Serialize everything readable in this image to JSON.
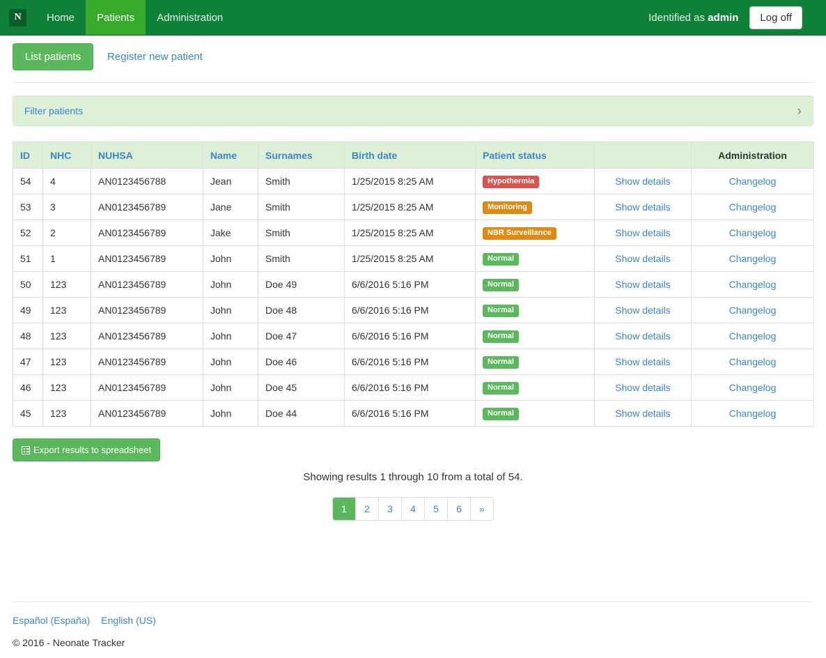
{
  "navbar": {
    "brand_letter": "N",
    "links": [
      {
        "label": "Home",
        "active": false
      },
      {
        "label": "Patients",
        "active": true
      },
      {
        "label": "Administration",
        "active": false
      }
    ],
    "identified_prefix": "Identified as",
    "identified_user": "admin",
    "logoff_label": "Log off"
  },
  "subnav": {
    "list_patients_label": "List patients",
    "register_label": "Register new patient"
  },
  "filter": {
    "title": "Filter patients",
    "chevron": "›"
  },
  "table": {
    "headers": [
      "ID",
      "NHC",
      "NUHSA",
      "Name",
      "Surnames",
      "Birth date",
      "Patient status",
      "",
      "Administration"
    ],
    "details_label": "Show details",
    "changelog_label": "Changelog",
    "rows": [
      {
        "id": "54",
        "nhc": "4",
        "nuhsa": "AN0123456788",
        "name": "Jean",
        "surnames": "Smith",
        "birth": "1/25/2015 8:25 AM",
        "status": "Hypothermia",
        "status_color": "red"
      },
      {
        "id": "53",
        "nhc": "3",
        "nuhsa": "AN0123456789",
        "name": "Jane",
        "surnames": "Smith",
        "birth": "1/25/2015 8:25 AM",
        "status": "Monitoring",
        "status_color": "orange"
      },
      {
        "id": "52",
        "nhc": "2",
        "nuhsa": "AN0123456789",
        "name": "Jake",
        "surnames": "Smith",
        "birth": "1/25/2015 8:25 AM",
        "status": "NBR Surveillance",
        "status_color": "orange"
      },
      {
        "id": "51",
        "nhc": "1",
        "nuhsa": "AN0123456789",
        "name": "John",
        "surnames": "Smith",
        "birth": "1/25/2015 8:25 AM",
        "status": "Normal",
        "status_color": "green"
      },
      {
        "id": "50",
        "nhc": "123",
        "nuhsa": "AN0123456789",
        "name": "John",
        "surnames": "Doe 49",
        "birth": "6/6/2016 5:16 PM",
        "status": "Normal",
        "status_color": "green"
      },
      {
        "id": "49",
        "nhc": "123",
        "nuhsa": "AN0123456789",
        "name": "John",
        "surnames": "Doe 48",
        "birth": "6/6/2016 5:16 PM",
        "status": "Normal",
        "status_color": "green"
      },
      {
        "id": "48",
        "nhc": "123",
        "nuhsa": "AN0123456789",
        "name": "John",
        "surnames": "Doe 47",
        "birth": "6/6/2016 5:16 PM",
        "status": "Normal",
        "status_color": "green"
      },
      {
        "id": "47",
        "nhc": "123",
        "nuhsa": "AN0123456789",
        "name": "John",
        "surnames": "Doe 46",
        "birth": "6/6/2016 5:16 PM",
        "status": "Normal",
        "status_color": "green"
      },
      {
        "id": "46",
        "nhc": "123",
        "nuhsa": "AN0123456789",
        "name": "John",
        "surnames": "Doe 45",
        "birth": "6/6/2016 5:16 PM",
        "status": "Normal",
        "status_color": "green"
      },
      {
        "id": "45",
        "nhc": "123",
        "nuhsa": "AN0123456789",
        "name": "John",
        "surnames": "Doe 44",
        "birth": "6/6/2016 5:16 PM",
        "status": "Normal",
        "status_color": "green"
      }
    ]
  },
  "export": {
    "label": "Export results to spreadsheet",
    "icon": "list-alt-icon"
  },
  "results": {
    "text": "Showing results 1 through 10 from a total of 54."
  },
  "pagination": {
    "pages": [
      "1",
      "2",
      "3",
      "4",
      "5",
      "6"
    ],
    "active": "1",
    "next_label": "»"
  },
  "footer": {
    "languages": [
      "Español (España)",
      "English (US)"
    ],
    "copyright": "© 2016 - Neonate Tracker"
  },
  "colors": {
    "navbar_green": "#0e8038",
    "active_tab_green": "#37aa2c",
    "button_green": "#5cb85c",
    "link_blue": "#3a87c8",
    "panel_green": "#dff0d8",
    "badge_red": "#d9534f",
    "badge_orange": "#df8a13",
    "badge_green": "#5cb85c"
  }
}
